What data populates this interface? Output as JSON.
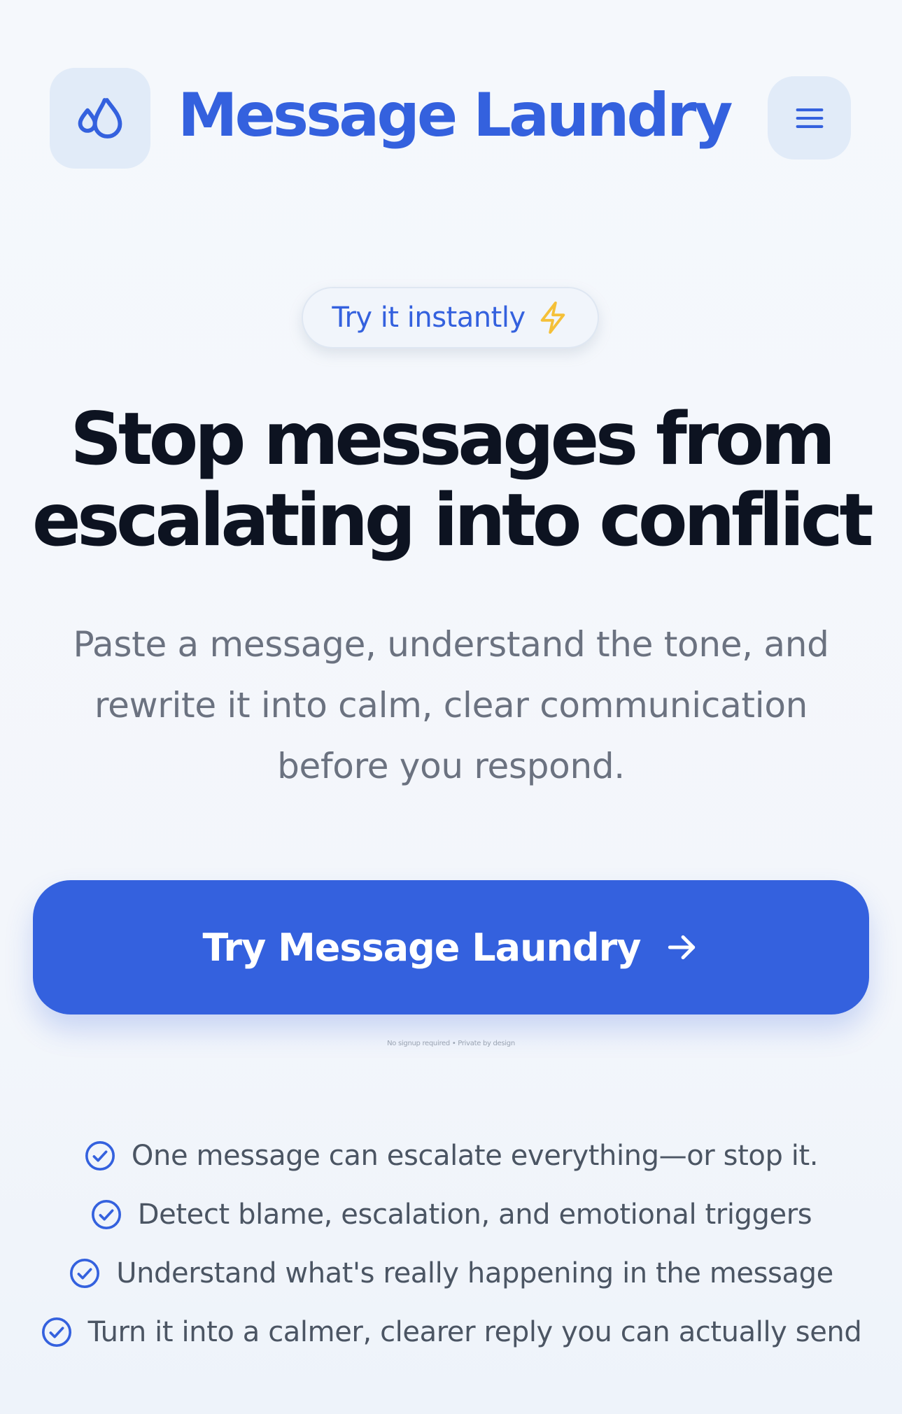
{
  "header": {
    "brand_name": "Message Laundry",
    "logo_icon": "droplets-icon",
    "menu_icon": "hamburger-menu-icon"
  },
  "hero": {
    "badge_text": "Try it instantly",
    "badge_icon": "lightning-bolt-icon",
    "headline_line1": "Stop messages from",
    "headline_line2": "escalating into conflict",
    "subtext_line1": "Paste a message, understand the tone, and",
    "subtext_line2": "rewrite it into calm, clear communication",
    "subtext_line3": "before you respond."
  },
  "cta": {
    "label": "Try Message Laundry",
    "icon": "arrow-right-icon",
    "fine_print": "No signup required • Private by design"
  },
  "features": [
    {
      "text": "One message can escalate everything—or stop it.",
      "icon": "check-circle-icon"
    },
    {
      "text": "Detect blame, escalation, and emotional triggers",
      "icon": "check-circle-icon"
    },
    {
      "text": "Understand what's really happening in the message",
      "icon": "check-circle-icon"
    },
    {
      "text": "Turn it into a calmer, clearer reply you can actually send",
      "icon": "check-circle-icon"
    }
  ],
  "colors": {
    "brand_blue": "#3461de",
    "tile_bg": "#e1ebf8",
    "page_bg": "#f4f7fb",
    "headline": "#0d1321",
    "body_text": "#6b7280",
    "muted_text": "#9aa3b2",
    "bolt_yellow": "#f5c038"
  }
}
